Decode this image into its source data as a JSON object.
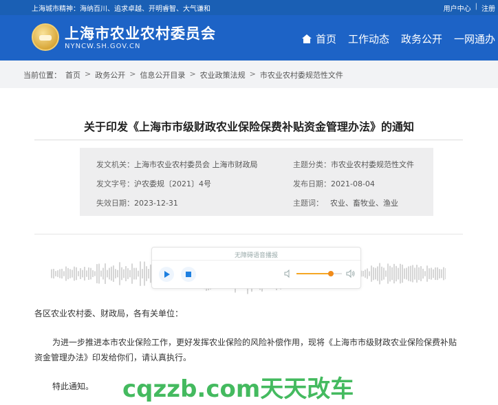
{
  "topbar": {
    "motto": "上海城市精神：海纳百川、追求卓越、开明睿智、大气谦和",
    "links": [
      "用户中心",
      "|",
      "注册"
    ]
  },
  "header": {
    "site_title": "上海市农业农村委员会",
    "site_domain": "NYNCW.SH.GOV.CN",
    "nav": [
      "首页",
      "工作动态",
      "政务公开",
      "一网通办"
    ]
  },
  "breadcrumb": {
    "prefix": "当前位置：",
    "items": [
      "首页",
      "政务公开",
      "信息公开目录",
      "农业政策法规",
      "市农业农村委规范性文件"
    ],
    "separator": ">"
  },
  "article": {
    "title": "关于印发《上海市市级财政农业保险保费补贴资金管理办法》的通知",
    "meta": {
      "issuer_label": "发文机关：",
      "issuer": "上海市农业农村委员会 上海市财政局",
      "doc_no_label": "发文字号：",
      "doc_no": "沪农委规〔2021〕4号",
      "expiry_label": "失效日期：",
      "expiry": "2023-12-31",
      "category_label": "主题分类：",
      "category": "市农业农村委规范性文件",
      "publish_label": "发布日期：",
      "publish": "2021-08-04",
      "keywords_label": "主题词：",
      "keywords": "农业、畜牧业、渔业"
    },
    "player": {
      "label": "无障碍语音播报",
      "volume_level": 0.75
    },
    "greeting": "各区农业农村委、财政局，各有关单位：",
    "paragraph": "为进一步推进本市农业保险工作，更好发挥农业保险的风险补偿作用，现将《上海市市级财政农业保险保费补贴资金管理办法》印发给你们，请认真执行。",
    "closing": "特此通知。"
  },
  "watermark": "cqzzb.com天天改车",
  "colors": {
    "header_blue": "#1d63c6",
    "accent_orange": "#f08b1a",
    "play_blue": "#1d7fe0",
    "watermark_green": "#35b552"
  }
}
